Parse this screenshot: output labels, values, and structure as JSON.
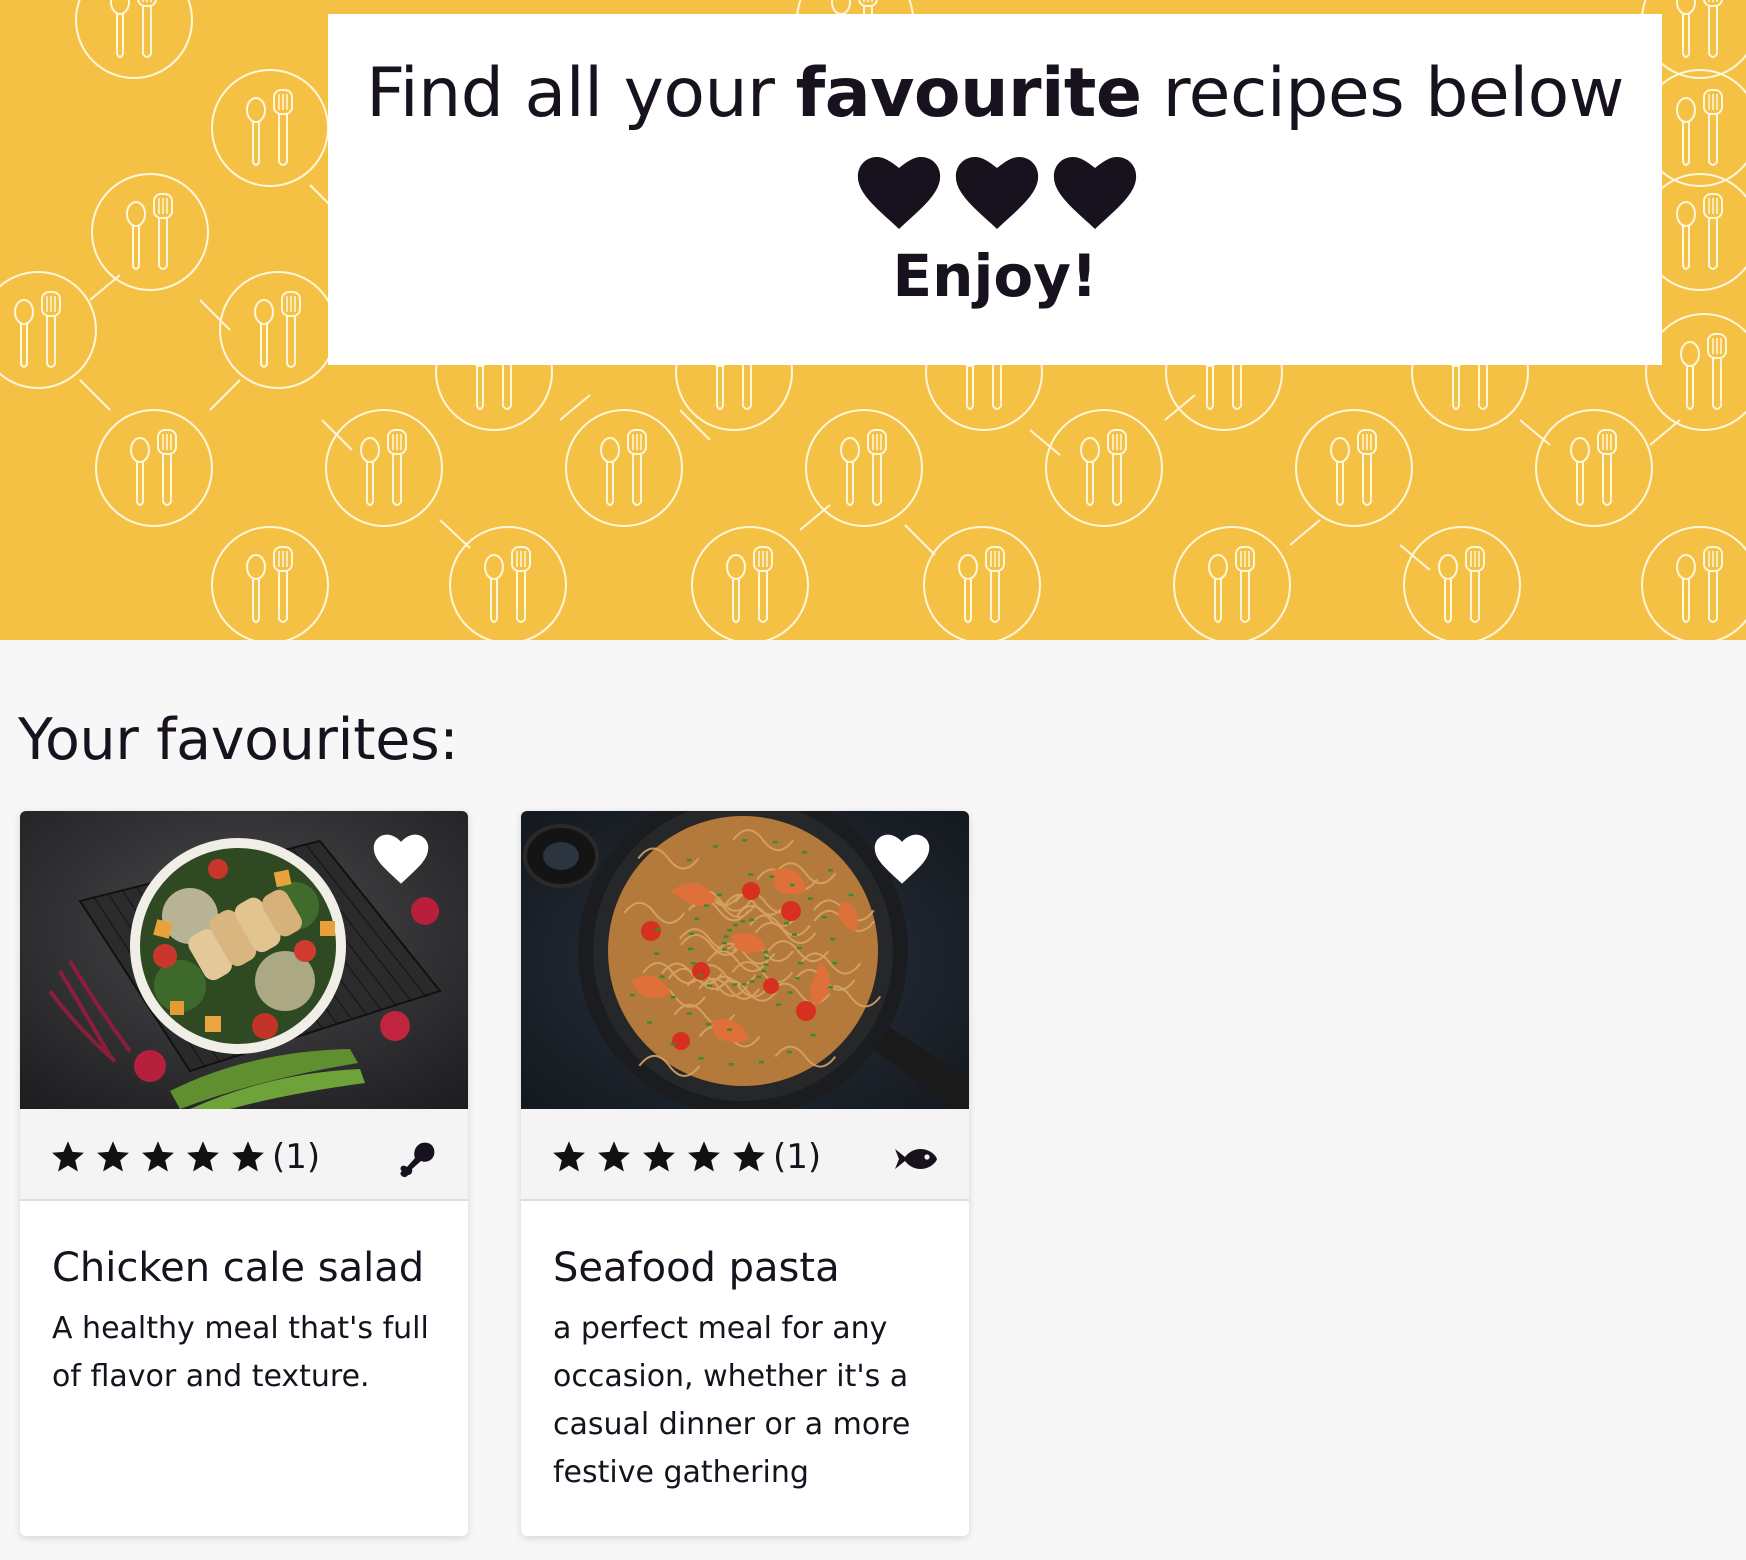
{
  "colors": {
    "hero_background": "#f4c145",
    "text": "#17121d",
    "page_background": "#f7f7f7"
  },
  "hero": {
    "title_part1": "Find all your ",
    "title_bold": "favourite",
    "title_part2": " recipes below",
    "hearts": [
      "heart-icon",
      "heart-icon",
      "heart-icon"
    ],
    "subtitle": "Enjoy!",
    "pattern_icon": "plate-with-spoon-and-spatula-icon"
  },
  "favourites": {
    "heading": "Your favourites:",
    "cards": [
      {
        "title": "Chicken cale salad",
        "description": "A healthy meal that's full of flavor and texture.",
        "rating": 5,
        "rating_max": 5,
        "rating_count": "(1)",
        "diet_icon": "chicken-leg-icon",
        "image": "chicken-salad-bowl",
        "favourite_icon": "heart-outline-icon"
      },
      {
        "title": "Seafood pasta",
        "description": "a perfect meal for any occasion, whether it's a casual dinner or a more festive gathering",
        "rating": 5,
        "rating_max": 5,
        "rating_count": "(1)",
        "diet_icon": "fish-icon",
        "image": "shrimp-spaghetti-pan",
        "favourite_icon": "heart-outline-icon"
      }
    ]
  }
}
